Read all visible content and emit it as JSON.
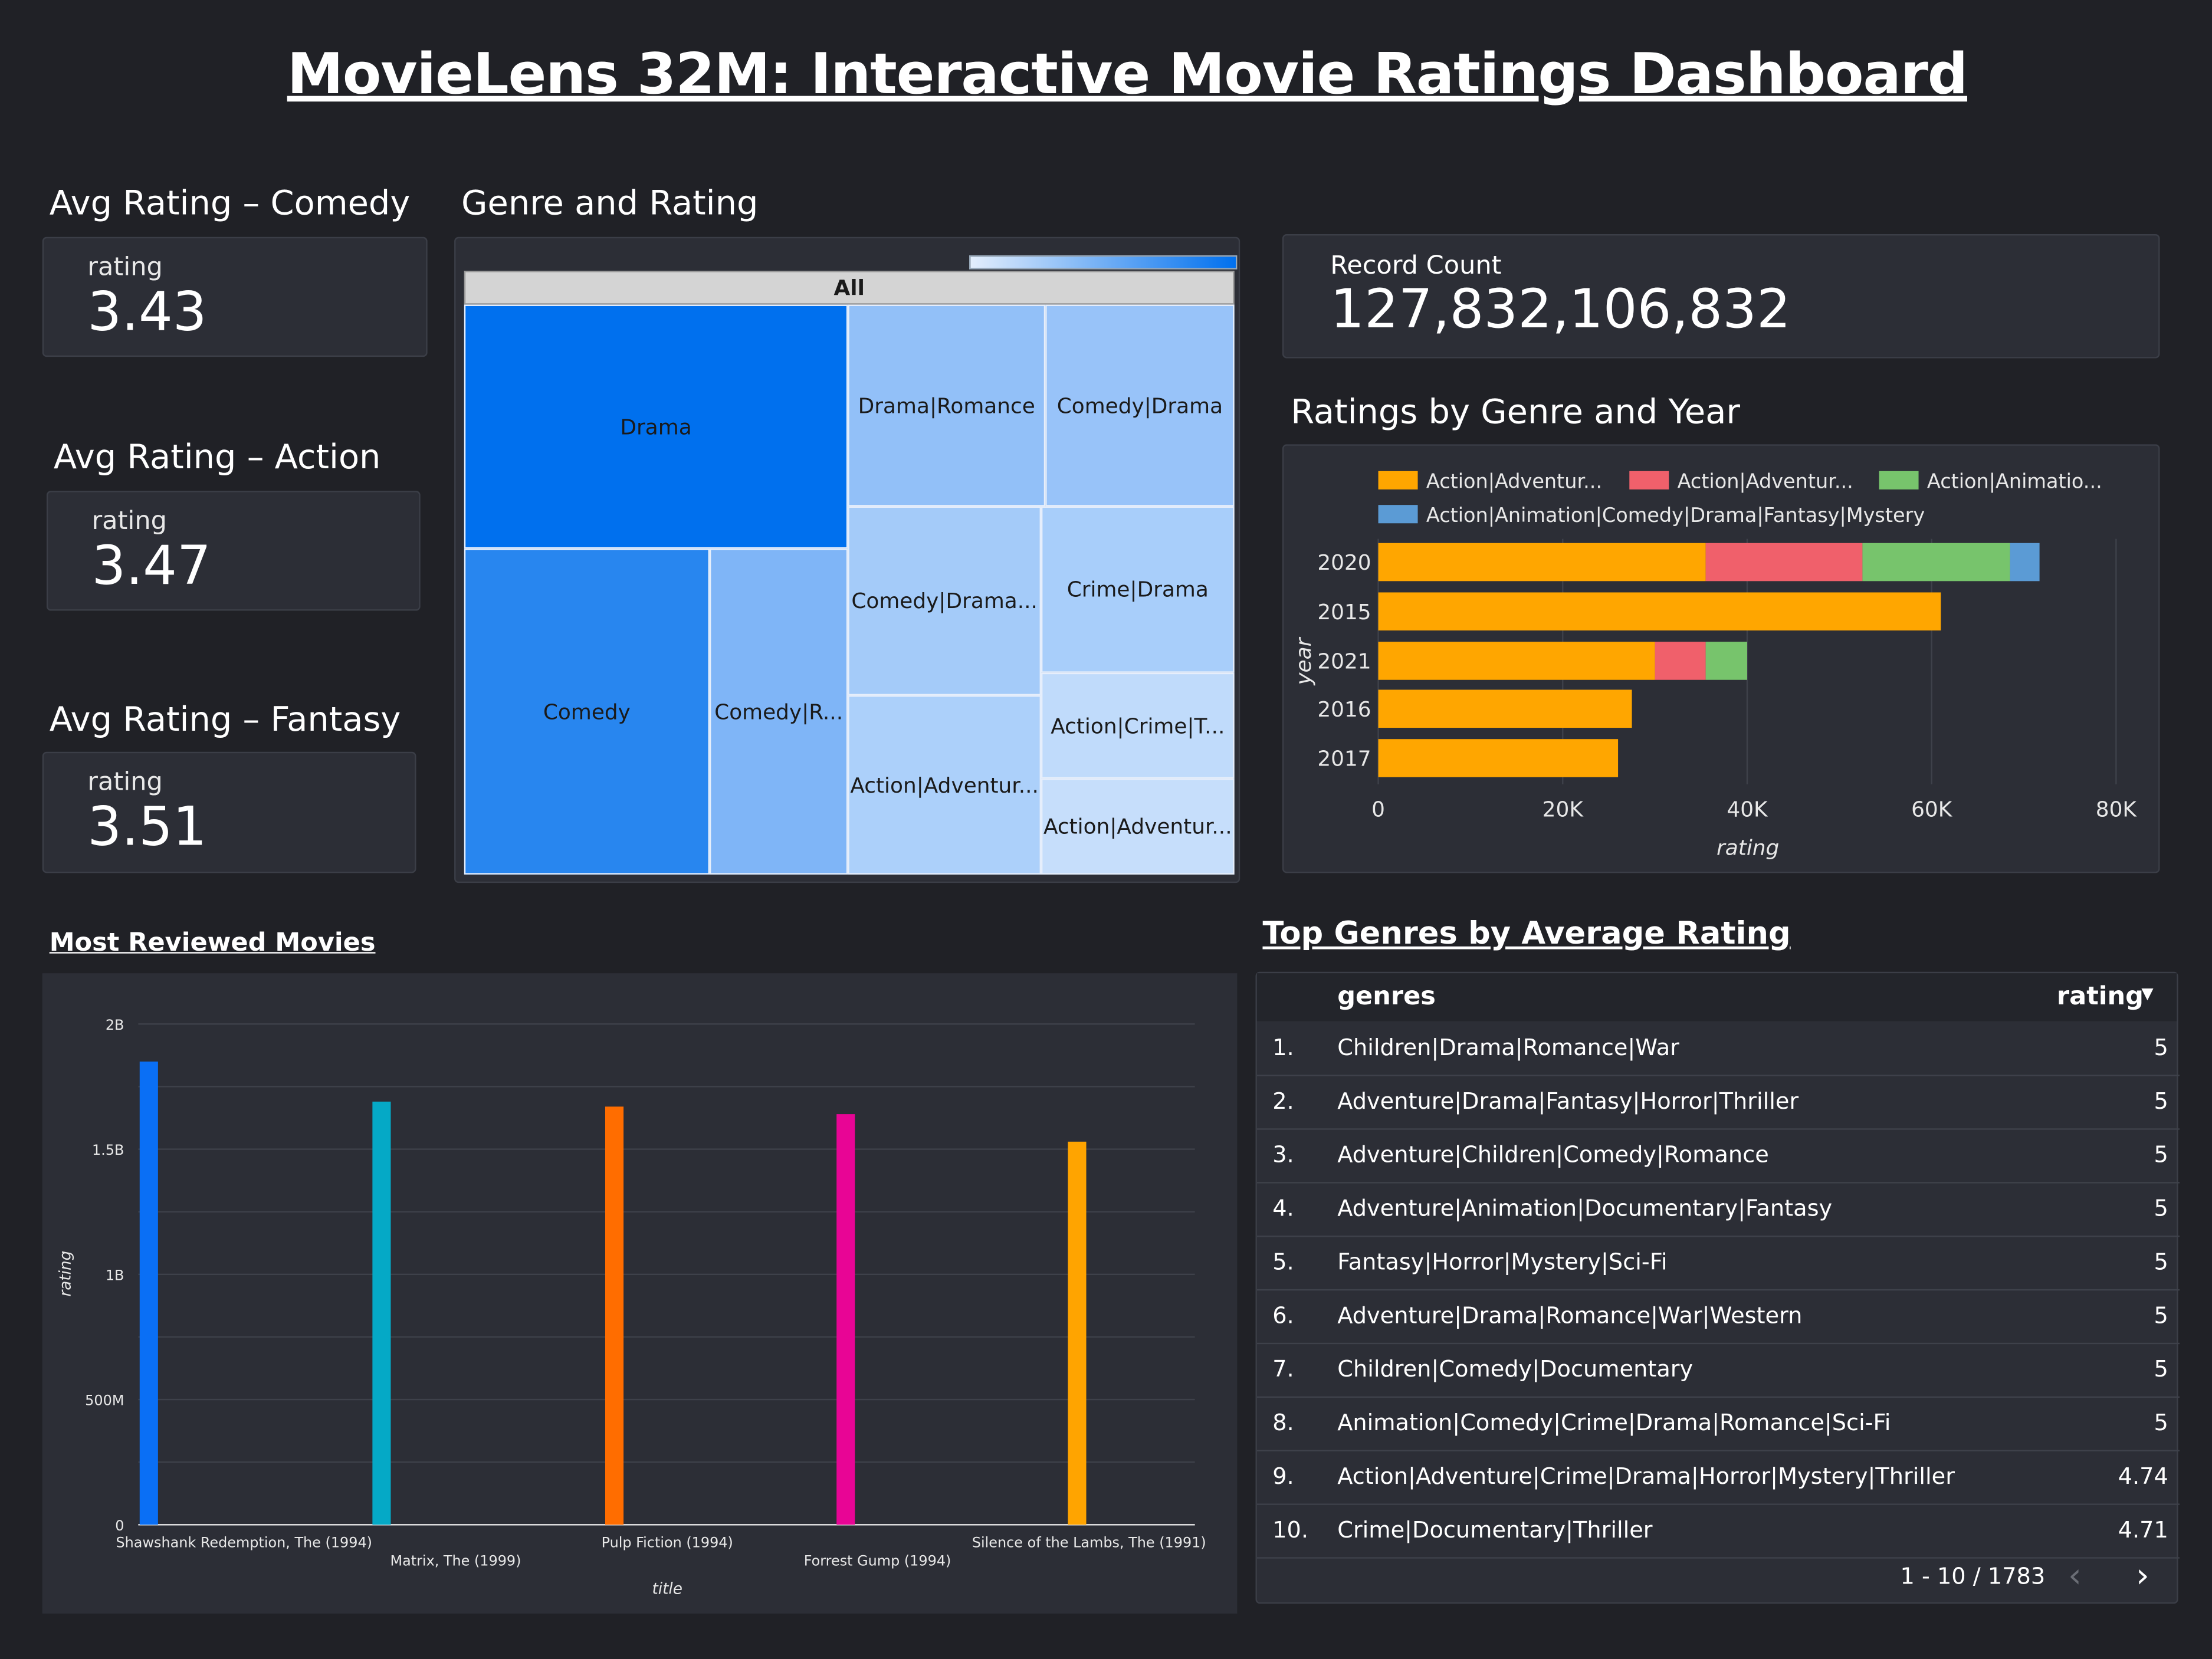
{
  "title": "MovieLens 32M: Interactive Movie Ratings Dashboard",
  "kpis": {
    "comedy": {
      "header": "Avg Rating – Comedy",
      "label": "rating",
      "value": "3.43"
    },
    "action": {
      "header": "Avg Rating – Action",
      "label": "rating",
      "value": "3.47"
    },
    "fantasy": {
      "header": "Avg Rating – Fantasy",
      "label": "rating",
      "value": "3.51"
    },
    "record_count": {
      "label": "Record Count",
      "value": "127,832,106,832"
    }
  },
  "colors": {
    "background": "#202126",
    "card": "#2c2e36",
    "orange": "#ffa600",
    "red": "#f0606b",
    "green": "#77c46c",
    "blue": "#5b9bd5",
    "bar_blue": "#0a6ff5",
    "bar_teal": "#05a9c6",
    "bar_orange": "#ff6d00",
    "bar_pink": "#e80595",
    "bar_yellow": "#ffa400"
  },
  "treemap": {
    "header": "Genre and Rating",
    "root_label": "All",
    "cells": [
      {
        "label": "Drama",
        "color": "#0070ee"
      },
      {
        "label": "Comedy",
        "color": "#2886ef"
      },
      {
        "label": "Comedy|R...",
        "color": "#7fb5f7"
      },
      {
        "label": "Drama|Romance",
        "color": "#92c0f8"
      },
      {
        "label": "Comedy|Drama",
        "color": "#98c3f9"
      },
      {
        "label": "Comedy|Drama...",
        "color": "#a4cbf9"
      },
      {
        "label": "Crime|Drama",
        "color": "#a8cefa"
      },
      {
        "label": "Action|Adventur...",
        "color": "#acd0fa"
      },
      {
        "label": "Action|Crime|T...",
        "color": "#c0dbfb"
      },
      {
        "label": "Action|Adventur...",
        "color": "#c6defb"
      }
    ]
  },
  "genre_year": {
    "header": "Ratings by Genre and Year",
    "legend": [
      "Action|Adventur...",
      "Action|Adventur...",
      "Action|Animatio...",
      "Action|Animation|Comedy|Drama|Fantasy|Mystery"
    ]
  },
  "most_reviewed": {
    "header": "Most Reviewed Movies"
  },
  "top_genres": {
    "header": "Top Genres by Average Rating",
    "col_genres": "genres",
    "col_rating": "rating",
    "sort_icon": "sort-down-icon",
    "rows": [
      {
        "idx": "1.",
        "genres": "Children|Drama|Romance|War",
        "rating": "5"
      },
      {
        "idx": "2.",
        "genres": "Adventure|Drama|Fantasy|Horror|Thriller",
        "rating": "5"
      },
      {
        "idx": "3.",
        "genres": "Adventure|Children|Comedy|Romance",
        "rating": "5"
      },
      {
        "idx": "4.",
        "genres": "Adventure|Animation|Documentary|Fantasy",
        "rating": "5"
      },
      {
        "idx": "5.",
        "genres": "Fantasy|Horror|Mystery|Sci-Fi",
        "rating": "5"
      },
      {
        "idx": "6.",
        "genres": "Adventure|Drama|Romance|War|Western",
        "rating": "5"
      },
      {
        "idx": "7.",
        "genres": "Children|Comedy|Documentary",
        "rating": "5"
      },
      {
        "idx": "8.",
        "genres": "Animation|Comedy|Crime|Drama|Romance|Sci-Fi",
        "rating": "5"
      },
      {
        "idx": "9.",
        "genres": "Action|Adventure|Crime|Drama|Horror|Mystery|Thriller",
        "rating": "4.74"
      },
      {
        "idx": "10.",
        "genres": "Crime|Documentary|Thriller",
        "rating": "4.71"
      }
    ],
    "pagination": "1 - 10 / 1783"
  },
  "chart_data": [
    {
      "type": "bar",
      "orientation": "horizontal",
      "stacked": true,
      "title": "Ratings by Genre and Year",
      "xlabel": "rating",
      "ylabel": "year",
      "categories": [
        "2020",
        "2015",
        "2021",
        "2016",
        "2017"
      ],
      "xlim": [
        0,
        80000
      ],
      "x_ticks": [
        "0",
        "20K",
        "40K",
        "60K",
        "80K"
      ],
      "series": [
        {
          "name": "Action|Adventur...",
          "color": "#ffa600",
          "values": [
            35500,
            61000,
            30000,
            27500,
            26000
          ]
        },
        {
          "name": "Action|Adventur...",
          "color": "#f0606b",
          "values": [
            17000,
            0,
            5500,
            0,
            0
          ]
        },
        {
          "name": "Action|Animatio...",
          "color": "#77c46c",
          "values": [
            16000,
            0,
            4500,
            0,
            0
          ]
        },
        {
          "name": "Action|Animation|Comedy|Drama|Fantasy|Mystery",
          "color": "#5b9bd5",
          "values": [
            3200,
            0,
            0,
            0,
            0
          ]
        }
      ],
      "grid": true,
      "legend": "top"
    },
    {
      "type": "bar",
      "title": "Most Reviewed Movies",
      "xlabel": "title",
      "ylabel": "rating",
      "categories": [
        "Shawshank Redemption, The (1994)",
        "Matrix, The (1999)",
        "Pulp Fiction (1994)",
        "Forrest Gump (1994)",
        "Silence of the Lambs, The (1991)"
      ],
      "values": [
        1850000000,
        1690000000,
        1670000000,
        1640000000,
        1530000000
      ],
      "colors": [
        "#0a6ff5",
        "#05a9c6",
        "#ff6d00",
        "#e80595",
        "#ffa400"
      ],
      "ylim": [
        0,
        2000000000
      ],
      "y_ticks": [
        "0",
        "500M",
        "1B",
        "1.5B",
        "2B"
      ],
      "grid": true
    },
    {
      "type": "treemap",
      "title": "Genre and Rating",
      "root": "All",
      "labels": [
        "Drama",
        "Comedy",
        "Comedy|R...",
        "Drama|Romance",
        "Comedy|Drama",
        "Comedy|Drama...",
        "Crime|Drama",
        "Action|Adventur...",
        "Action|Crime|T...",
        "Action|Adventur..."
      ]
    }
  ]
}
